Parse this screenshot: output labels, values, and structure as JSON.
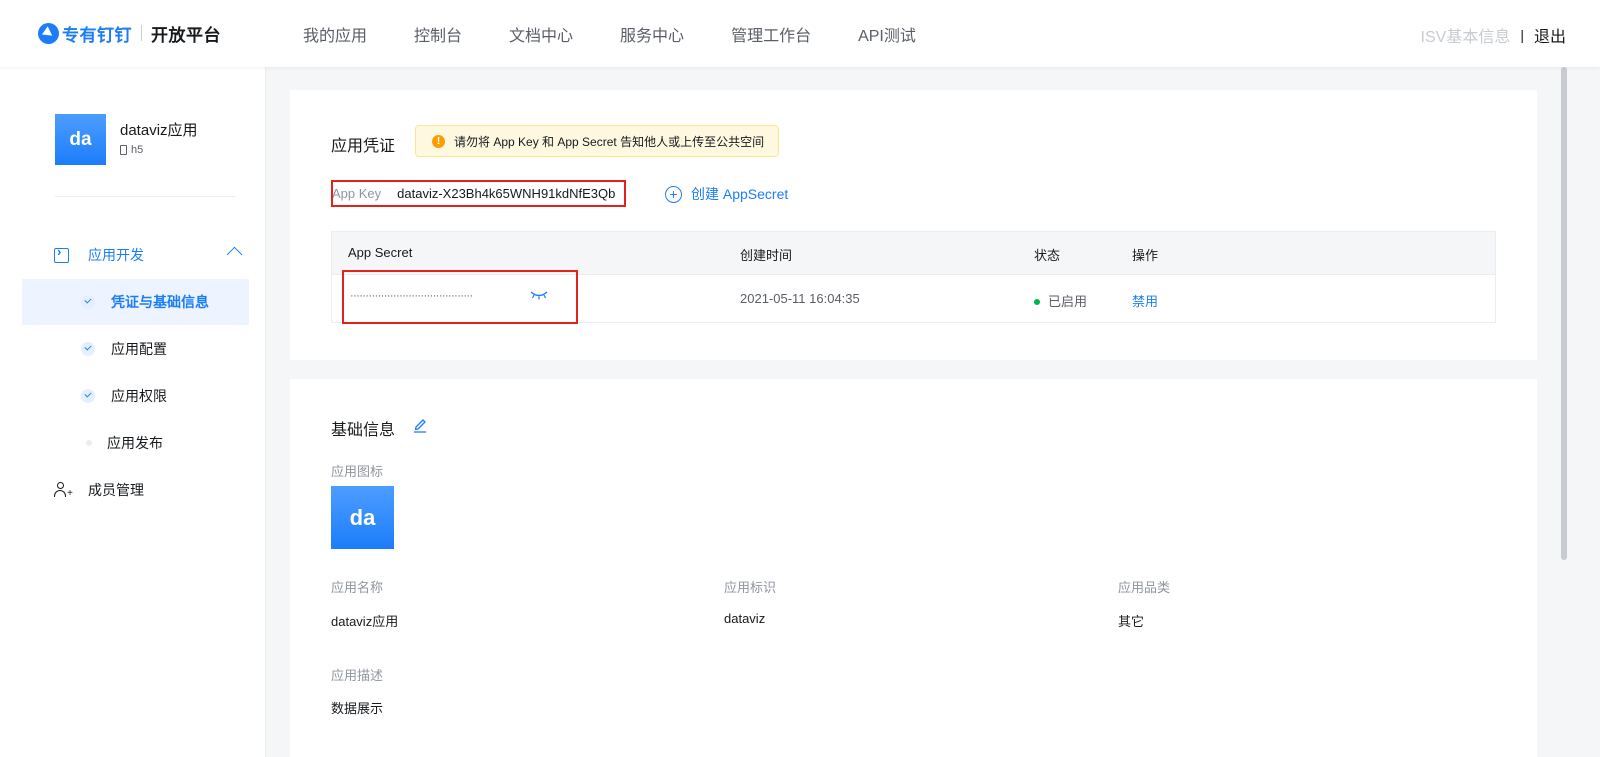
{
  "header": {
    "brand": "专有钉钉",
    "platform": "开放平台",
    "nav": [
      "我的应用",
      "控制台",
      "文档中心",
      "服务中心",
      "管理工作台",
      "API测试"
    ],
    "isv_info": "ISV基本信息",
    "separator": "|",
    "logout": "退出"
  },
  "sidebar": {
    "app_icon_text": "da",
    "app_name": "dataviz应用",
    "app_type": "h5",
    "group_label": "应用开发",
    "items": [
      {
        "label": "凭证与基础信息"
      },
      {
        "label": "应用配置"
      },
      {
        "label": "应用权限"
      },
      {
        "label": "应用发布"
      }
    ],
    "member_label": "成员管理"
  },
  "credentials": {
    "title": "应用凭证",
    "warning": "请勿将 App Key 和 App Secret 告知他人或上传至公共空间",
    "app_key_label": "App Key",
    "app_key_value": "dataviz-X23Bh4k65WNH91kdNfE3Qb",
    "create_secret": "创建 AppSecret",
    "table": {
      "headers": [
        "App Secret",
        "创建时间",
        "状态",
        "操作"
      ],
      "row": {
        "secret": "········································",
        "created": "2021-05-11 16:04:35",
        "status": "已启用",
        "action": "禁用"
      }
    }
  },
  "basic_info": {
    "title": "基础信息",
    "icon_label": "应用图标",
    "icon_text": "da",
    "name_label": "应用名称",
    "name_value": "dataviz应用",
    "id_label": "应用标识",
    "id_value": "dataviz",
    "category_label": "应用品类",
    "category_value": "其它",
    "desc_label": "应用描述",
    "desc_value": "数据展示"
  },
  "colors": {
    "accent": "#1c7dfa",
    "highlight_border": "#e2231a",
    "status_enabled": "#00b642",
    "warning_bg": "#fff8e1"
  }
}
